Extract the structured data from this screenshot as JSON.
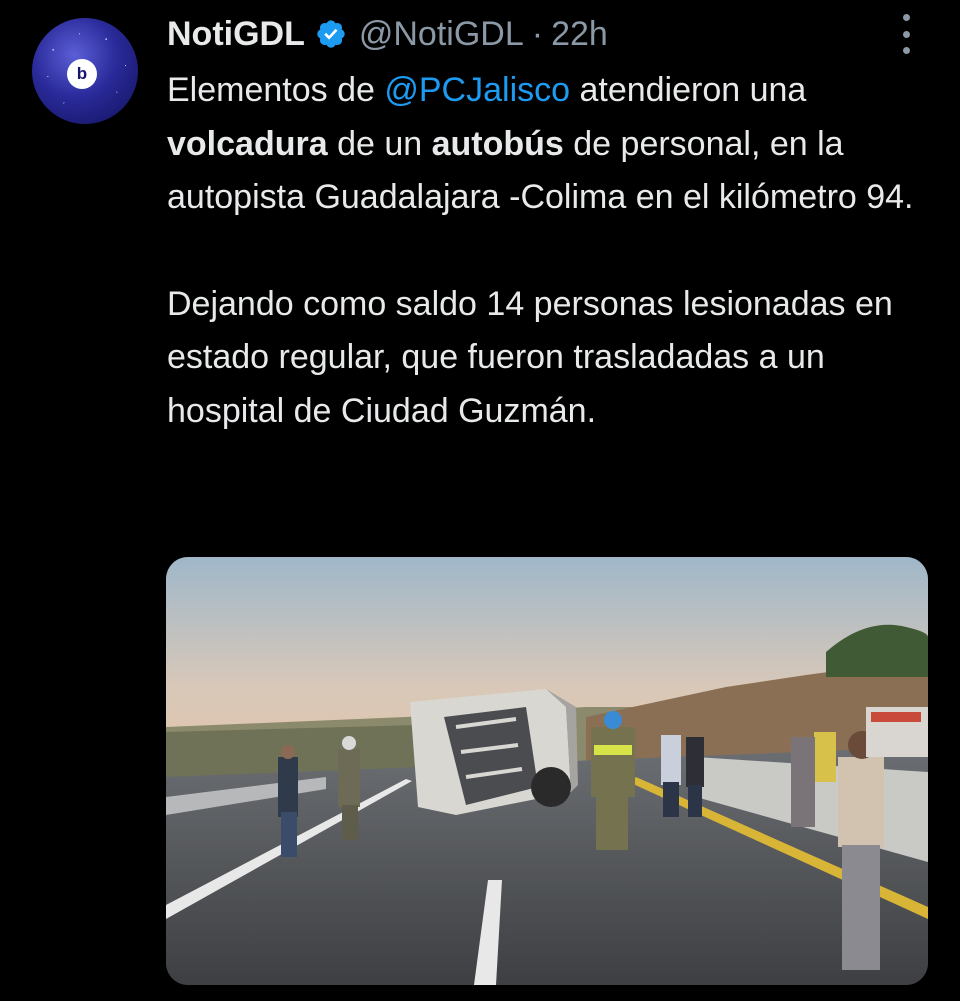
{
  "tweet": {
    "author": {
      "display_name": "NotiGDL",
      "handle": "@NotiGDL",
      "separator": "·",
      "time": "22h",
      "avatar_logo": "b",
      "verified_icon": "verified-badge-icon"
    },
    "more_icon": "more-vertical-icon",
    "paragraph1": {
      "t1": "Elementos de ",
      "mention": "@PCJalisco",
      "t2": " atendieron una ",
      "bold1": "volcadura",
      "t3": " de un ",
      "bold2": "autobús",
      "t4": " de personal, en la autopista Guadalajara -Colima en el kilómetro 94."
    },
    "paragraph2": "Dejando como saldo 14 personas lesionadas en estado regular, que fueron trasladadas a un hospital de Ciudad Guzmán.",
    "media": {
      "kind": "photo"
    }
  },
  "colors": {
    "background": "#000000",
    "text": "#e7e9ea",
    "muted": "#8b98a5",
    "accent": "#1d9bf0"
  }
}
